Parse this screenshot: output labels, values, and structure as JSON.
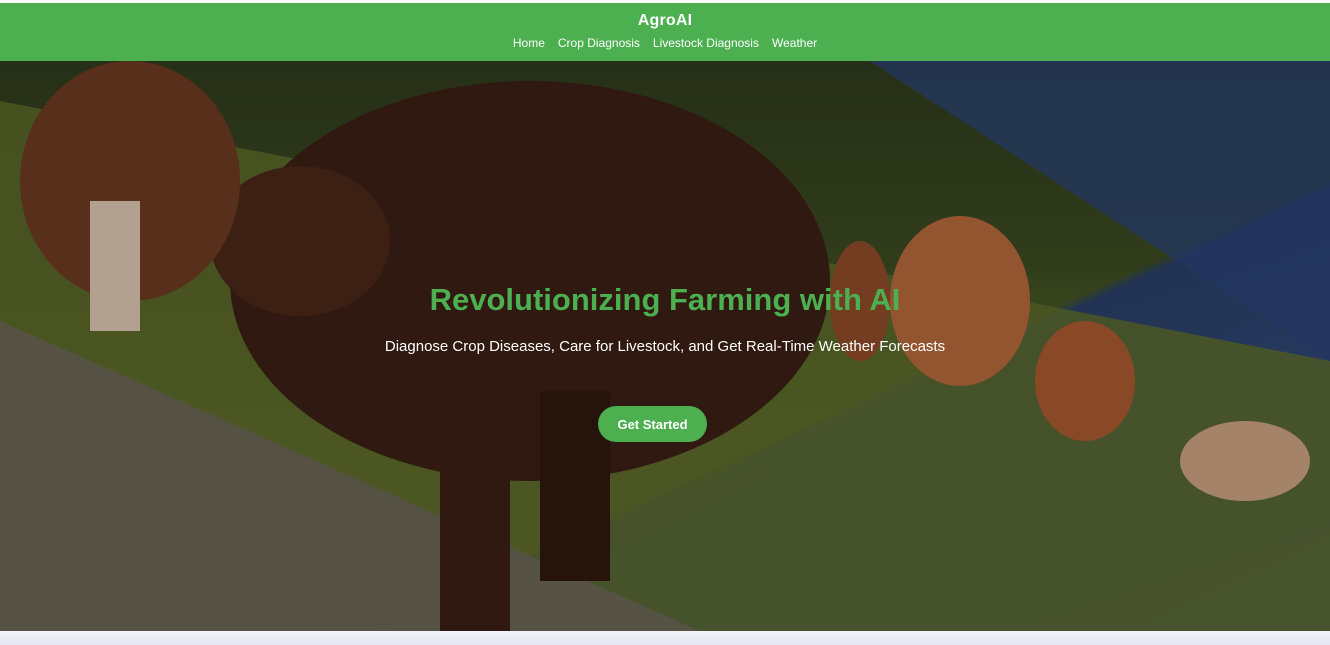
{
  "header": {
    "brand": "AgroAI",
    "nav": [
      {
        "label": "Home"
      },
      {
        "label": "Crop Diagnosis"
      },
      {
        "label": "Livestock Diagnosis"
      },
      {
        "label": "Weather"
      }
    ]
  },
  "hero": {
    "title": "Revolutionizing Farming with AI",
    "subtitle": "Diagnose Crop Diseases, Care for Livestock, and Get Real-Time Weather Forecasts",
    "cta_label": "Get Started",
    "background_image": "cows-grazing-on-hillside"
  },
  "colors": {
    "accent": "#4CAF50",
    "text_light": "#FFFFFF"
  }
}
